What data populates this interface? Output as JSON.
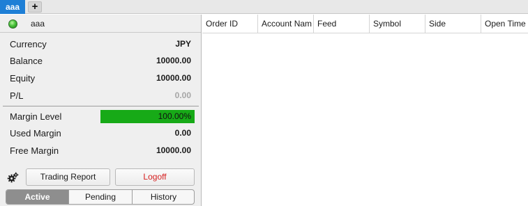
{
  "tabs": {
    "active_label": "aaa",
    "add_label": "+"
  },
  "account": {
    "name": "aaa",
    "status_color": "#48c23a",
    "fields": [
      {
        "label": "Currency",
        "value": "JPY"
      },
      {
        "label": "Balance",
        "value": "10000.00"
      },
      {
        "label": "Equity",
        "value": "10000.00"
      },
      {
        "label": "P/L",
        "value": "0.00"
      }
    ],
    "margin_level": {
      "label": "Margin Level",
      "value": "100.00%",
      "fraction": 1.0,
      "color": "#17aa17"
    },
    "used_margin": {
      "label": "Used Margin",
      "value": "0.00"
    },
    "free_margin": {
      "label": "Free Margin",
      "value": "10000.00"
    }
  },
  "actions": {
    "settings_icon": "gears-icon",
    "trading_report_label": "Trading Report",
    "logoff_label": "Logoff",
    "logoff_color": "#d61f1f"
  },
  "views": {
    "active": "Active",
    "pending": "Pending",
    "history": "History",
    "selected": "Active"
  },
  "grid": {
    "columns": [
      "Order ID",
      "Account Nam",
      "Feed",
      "Symbol",
      "Side",
      "Open Time"
    ],
    "rows": []
  }
}
